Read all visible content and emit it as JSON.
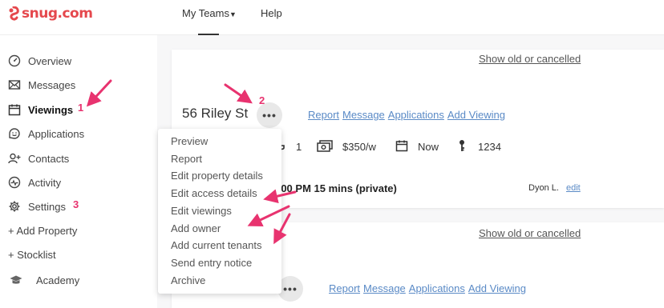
{
  "brand": {
    "name": "snug.com",
    "color": "#e5484d"
  },
  "topnav": {
    "teams_label": "My Teams",
    "help_label": "Help"
  },
  "sidebar": {
    "items": [
      {
        "label": "Overview",
        "icon": "gauge-icon"
      },
      {
        "label": "Messages",
        "icon": "envelope-icon"
      },
      {
        "label": "Viewings",
        "icon": "calendar-icon"
      },
      {
        "label": "Applications",
        "icon": "smile-icon"
      },
      {
        "label": "Contacts",
        "icon": "contacts-icon"
      },
      {
        "label": "Activity",
        "icon": "pulse-icon"
      },
      {
        "label": "Settings",
        "icon": "gear-icon"
      },
      {
        "label": "+ Add Property"
      },
      {
        "label": "+ Stocklist"
      },
      {
        "label": "Academy",
        "icon": "graduation-cap-icon"
      }
    ]
  },
  "property": {
    "title": "56 Riley St",
    "actions": [
      "Report",
      "Message",
      "Applications",
      "Add Viewing"
    ],
    "show_old_label": "Show old or cancelled",
    "bathrooms": "1",
    "rent": "$350/w",
    "available": "Now",
    "key_code": "1234",
    "viewing_text": ":00 PM 15 mins  (private)",
    "agent_name": "Dyon L.",
    "edit_label": "edit"
  },
  "second_card": {
    "show_old_label": "Show old or cancelled",
    "actions": [
      "Report",
      "Message",
      "Applications",
      "Add Viewing"
    ]
  },
  "dropdown_menu": {
    "items": [
      "Preview",
      "Report",
      "Edit property details",
      "Edit access details",
      "Edit viewings",
      "Add owner",
      "Add current tenants",
      "Send entry notice",
      "Archive"
    ]
  },
  "annotations": {
    "numbers": [
      "1",
      "2",
      "3"
    ],
    "color": "#e8336f"
  },
  "colors": {
    "link": "#5a8ac6",
    "main_bg": "#f7f7f8"
  }
}
